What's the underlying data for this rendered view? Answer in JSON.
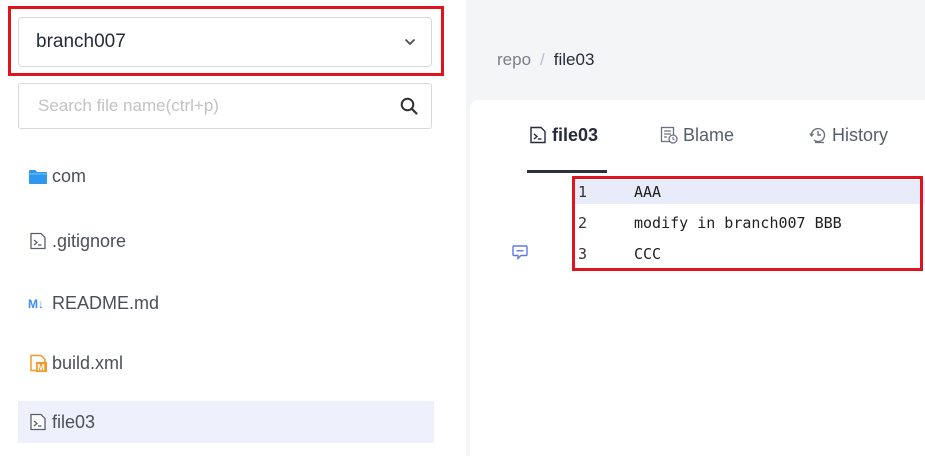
{
  "sidebar": {
    "branch_selector": {
      "value": "branch007",
      "icon": "chevron-down-icon"
    },
    "search": {
      "placeholder": "Search file name(ctrl+p)",
      "value": "",
      "icon": "search-icon"
    },
    "tree": [
      {
        "label": "com",
        "icon": "folder-icon",
        "type": "folder"
      },
      {
        "label": ".gitignore",
        "icon": "terminal-file-icon",
        "type": "file"
      },
      {
        "label": "README.md",
        "icon": "markdown-icon",
        "type": "file"
      },
      {
        "label": "build.xml",
        "icon": "maven-file-icon",
        "type": "file"
      },
      {
        "label": "file03",
        "icon": "terminal-file-icon",
        "type": "file",
        "selected": true
      }
    ]
  },
  "main": {
    "breadcrumb": {
      "root": "repo",
      "separator": "/",
      "current": "file03"
    },
    "tabs": [
      {
        "label": "file03",
        "icon": "terminal-file-icon",
        "active": true
      },
      {
        "label": "Blame",
        "icon": "blame-icon",
        "active": false
      },
      {
        "label": "History",
        "icon": "history-icon",
        "active": false
      }
    ],
    "code": [
      {
        "line": "1",
        "text": "AAA"
      },
      {
        "line": "2",
        "text": "modify in branch007 BBB"
      },
      {
        "line": "3",
        "text": "CCC"
      }
    ]
  },
  "colors": {
    "highlight_border": "#e0141e",
    "selected_row": "#eef1fb",
    "folder": "#2e98ee",
    "markdown": "#3d8eea",
    "maven": "#f39b26",
    "comment_icon": "#5e7ce0"
  }
}
